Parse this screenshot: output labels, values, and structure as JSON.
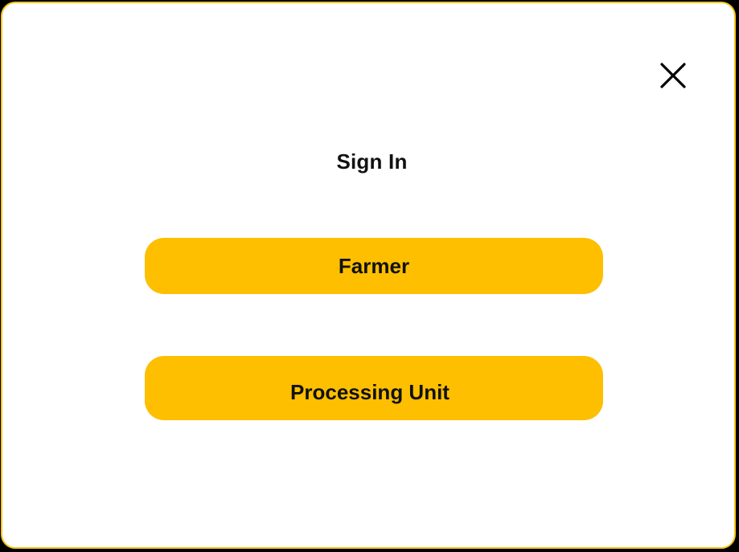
{
  "dialog": {
    "title": "Sign In",
    "close_icon": "close-icon",
    "options": [
      {
        "label": "Farmer"
      },
      {
        "label": "Processing Unit"
      }
    ]
  },
  "colors": {
    "accent": "#fdbf00",
    "border": "#f5c518",
    "background": "#ffffff",
    "text": "#111111"
  }
}
